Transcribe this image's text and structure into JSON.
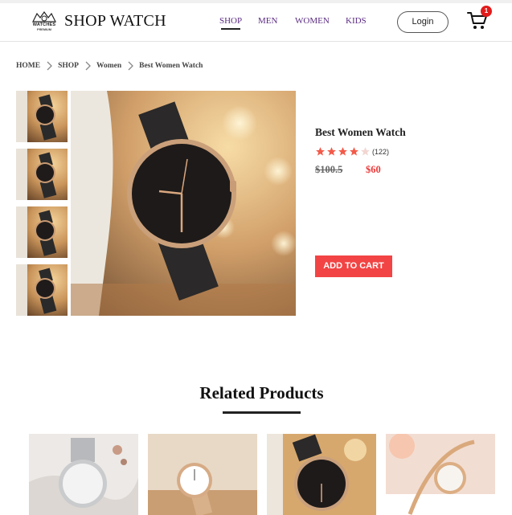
{
  "header": {
    "logo_text": "WATCHES",
    "logo_sub": "PREMIUM",
    "brand": "SHOP WATCH",
    "nav": [
      "SHOP",
      "MEN",
      "WOMEN",
      "KIDS"
    ],
    "login_label": "Login",
    "cart_count": "1"
  },
  "breadcrumb": [
    "HOME",
    "SHOP",
    "Women",
    "Best Women Watch"
  ],
  "product": {
    "title": "Best Women Watch",
    "rating": 4,
    "rating_max": 5,
    "reviews": "(122)",
    "old_price": "$100.5",
    "new_price": "$60",
    "add_to_cart": "ADD TO CART"
  },
  "related": {
    "title": "Related Products"
  },
  "colors": {
    "accent_red": "#f24444",
    "nav_purple": "#5b2c83",
    "star": "#f25b4a"
  }
}
